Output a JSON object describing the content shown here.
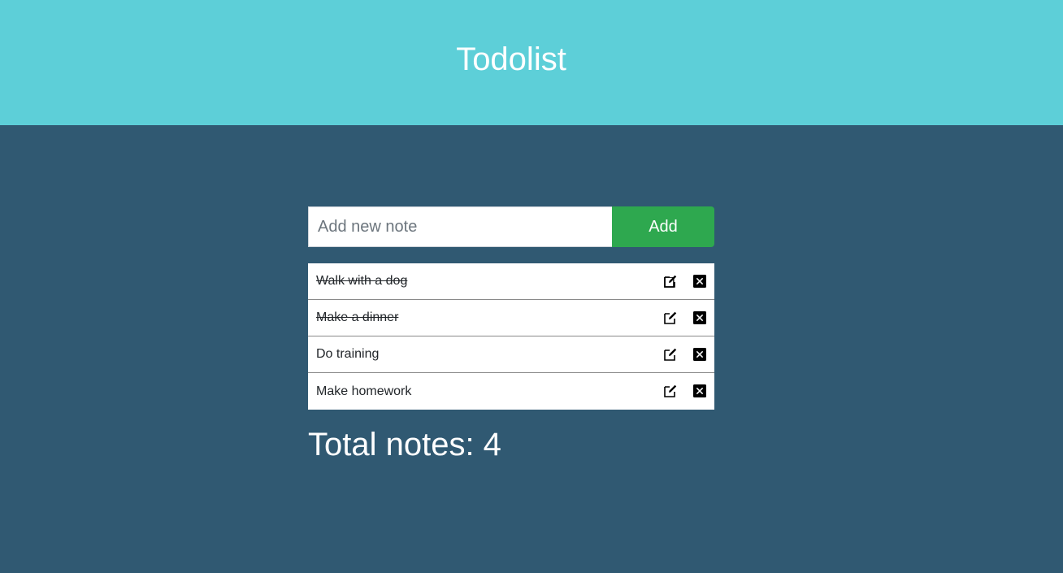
{
  "header": {
    "title": "Todolist"
  },
  "add_form": {
    "placeholder": "Add new note",
    "value": "",
    "add_label": "Add"
  },
  "notes": [
    {
      "text": "Walk with a dog",
      "done": true
    },
    {
      "text": "Make a dinner",
      "done": true
    },
    {
      "text": "Do training",
      "done": false
    },
    {
      "text": "Make homework",
      "done": false
    }
  ],
  "total": {
    "label": "Total notes: 4"
  },
  "colors": {
    "header_bg": "#5dcfd8",
    "page_bg": "#305972",
    "add_button_bg": "#2ea84f"
  },
  "icons": {
    "edit": "edit-icon",
    "delete": "close-icon"
  }
}
